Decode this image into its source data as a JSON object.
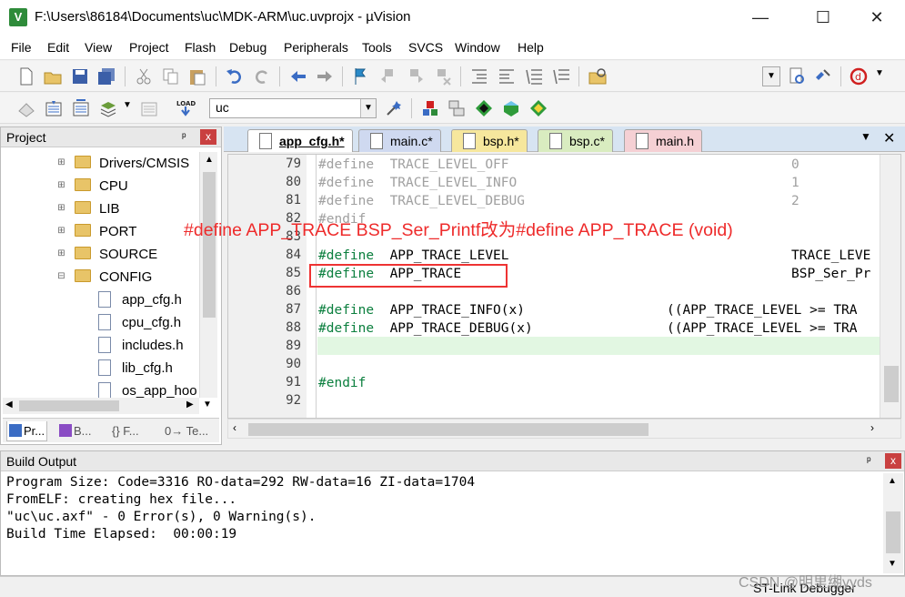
{
  "window": {
    "title": "F:\\Users\\86184\\Documents\\uc\\MDK-ARM\\uc.uvprojx - µVision",
    "minimize": "—",
    "maximize": "☐",
    "close": "✕"
  },
  "menu": [
    "File",
    "Edit",
    "View",
    "Project",
    "Flash",
    "Debug",
    "Peripherals",
    "Tools",
    "SVCS",
    "Window",
    "Help"
  ],
  "target": {
    "value": "uc"
  },
  "project": {
    "title": "Project",
    "pin": "ᵖ",
    "close": "x",
    "tree": [
      {
        "label": "Drivers/CMSIS",
        "type": "folder",
        "expanded": false
      },
      {
        "label": "CPU",
        "type": "folder",
        "expanded": false
      },
      {
        "label": "LIB",
        "type": "folder",
        "expanded": false
      },
      {
        "label": "PORT",
        "type": "folder",
        "expanded": false
      },
      {
        "label": "SOURCE",
        "type": "folder",
        "expanded": false
      },
      {
        "label": "CONFIG",
        "type": "folder",
        "expanded": true
      },
      {
        "label": "app_cfg.h",
        "type": "file"
      },
      {
        "label": "cpu_cfg.h",
        "type": "file"
      },
      {
        "label": "includes.h",
        "type": "file"
      },
      {
        "label": "lib_cfg.h",
        "type": "file"
      },
      {
        "label": "os_app_hook",
        "type": "file"
      }
    ],
    "tabs": [
      {
        "label": "Pr...",
        "icon": "project-icon"
      },
      {
        "label": "B...",
        "icon": "books-icon"
      },
      {
        "label": "{} F...",
        "icon": "functions-icon"
      },
      {
        "label": "0→ Te...",
        "icon": "templates-icon"
      }
    ]
  },
  "editor": {
    "tabs": [
      {
        "label": "app_cfg.h*",
        "active": true,
        "color": "#e9d48a"
      },
      {
        "label": "main.c*",
        "active": false,
        "color": "#cfd9f0"
      },
      {
        "label": "bsp.h*",
        "active": false,
        "color": "#f6e79d"
      },
      {
        "label": "bsp.c*",
        "active": false,
        "color": "#d9ecc0"
      },
      {
        "label": "main.h",
        "active": false,
        "color": "#f5d0d4"
      }
    ],
    "lines": [
      {
        "n": "79",
        "kw": "#define",
        "name": "  TRACE_LEVEL_OFF",
        "value": "0",
        "dim": true
      },
      {
        "n": "80",
        "kw": "#define",
        "name": "  TRACE_LEVEL_INFO",
        "value": "1",
        "dim": true
      },
      {
        "n": "81",
        "kw": "#define",
        "name": "  TRACE_LEVEL_DEBUG",
        "value": "2",
        "dim": true
      },
      {
        "n": "82",
        "kw": "#endif",
        "name": "",
        "value": "",
        "dim": true
      },
      {
        "n": "83",
        "kw": "",
        "name": "",
        "value": "",
        "dim": false
      },
      {
        "n": "84",
        "kw": "#define",
        "name": "  APP_TRACE_LEVEL",
        "value": "TRACE_LEVE",
        "dim": false
      },
      {
        "n": "85",
        "kw": "#define",
        "name": "  APP_TRACE",
        "value": "BSP_Ser_Pr",
        "dim": false
      },
      {
        "n": "86",
        "kw": "",
        "name": "",
        "value": "",
        "dim": false
      },
      {
        "n": "87",
        "kw": "#define",
        "name": "  APP_TRACE_INFO(x)",
        "value": "((APP_TRACE_LEVEL >= TRA",
        "dim": false
      },
      {
        "n": "88",
        "kw": "#define",
        "name": "  APP_TRACE_DEBUG(x)",
        "value": "((APP_TRACE_LEVEL >= TRA",
        "dim": false
      },
      {
        "n": "89",
        "kw": "",
        "name": "",
        "value": "",
        "dim": false
      },
      {
        "n": "90",
        "kw": "",
        "name": "",
        "value": "",
        "dim": false
      },
      {
        "n": "91",
        "kw": "#endif",
        "name": "",
        "value": "",
        "dim": false
      },
      {
        "n": "92",
        "kw": "",
        "name": "",
        "value": "",
        "dim": false
      }
    ],
    "annotation": "#define APP_TRACE BSP_Ser_Printf改为#define APP_TRACE (void)"
  },
  "build_output": {
    "title": "Build Output",
    "lines": [
      "Program Size: Code=3316 RO-data=292 RW-data=16 ZI-data=1704",
      "FromELF: creating hex file...",
      "\"uc\\uc.axf\" - 0 Error(s), 0 Warning(s).",
      "Build Time Elapsed:  00:00:19"
    ]
  },
  "status": {
    "debugger": "ST-Link Debugger"
  },
  "watermark": "CSDN @明里缃yyds"
}
